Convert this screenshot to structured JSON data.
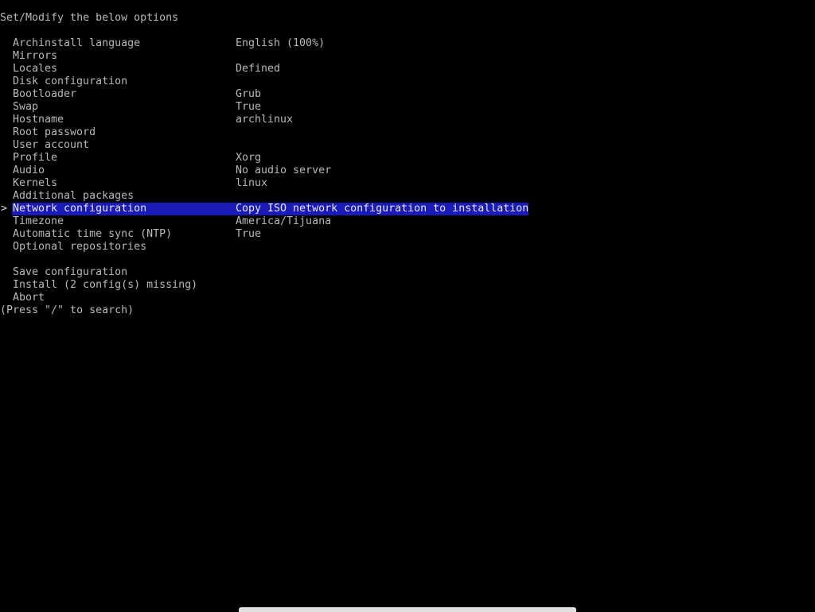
{
  "header": {
    "title": "Set/Modify the below options"
  },
  "cursor_glyph": ">",
  "options": [
    {
      "label": "Archinstall language",
      "value": "English (100%)"
    },
    {
      "label": "Mirrors",
      "value": ""
    },
    {
      "label": "Locales",
      "value": "Defined"
    },
    {
      "label": "Disk configuration",
      "value": ""
    },
    {
      "label": "Bootloader",
      "value": "Grub"
    },
    {
      "label": "Swap",
      "value": "True"
    },
    {
      "label": "Hostname",
      "value": "archlinux"
    },
    {
      "label": "Root password",
      "value": ""
    },
    {
      "label": "User account",
      "value": ""
    },
    {
      "label": "Profile",
      "value": "Xorg"
    },
    {
      "label": "Audio",
      "value": "No audio server"
    },
    {
      "label": "Kernels",
      "value": "linux"
    },
    {
      "label": "Additional packages",
      "value": ""
    },
    {
      "label": "Network configuration",
      "value": "Copy ISO network configuration to installation",
      "selected": true
    },
    {
      "label": "Timezone",
      "value": "America/Tijuana"
    },
    {
      "label": "Automatic time sync (NTP)",
      "value": "True"
    },
    {
      "label": "Optional repositories",
      "value": ""
    }
  ],
  "actions": [
    {
      "label": "Save configuration"
    },
    {
      "label": "Install (2 config(s) missing)"
    },
    {
      "label": "Abort"
    }
  ],
  "footer": {
    "hint": "(Press \"/\" to search)"
  },
  "colors": {
    "background": "#000000",
    "text": "#b8b8b8",
    "selection": "#1a1ab8"
  }
}
